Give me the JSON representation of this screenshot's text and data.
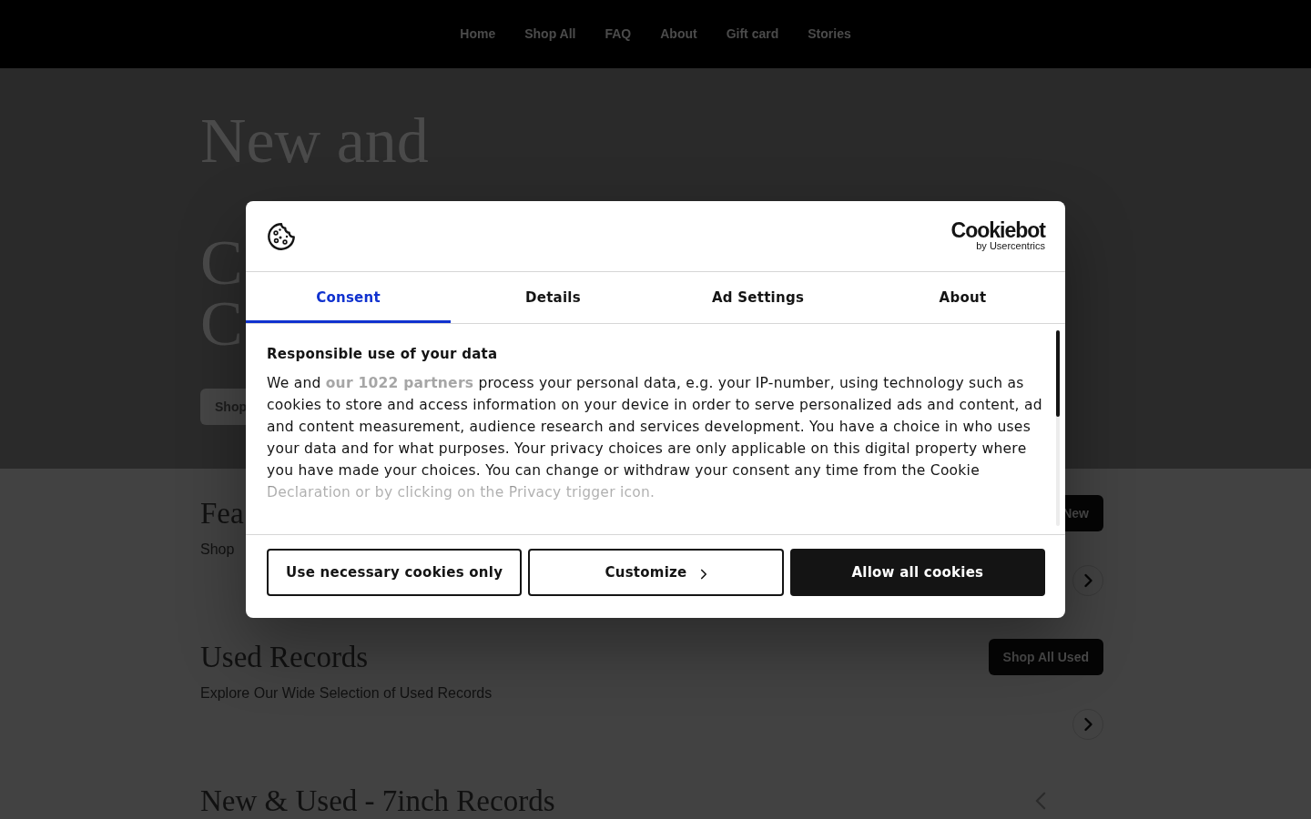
{
  "nav": {
    "links": [
      "Home",
      "Shop All",
      "FAQ",
      "About",
      "Gift card",
      "Stories"
    ]
  },
  "hero": {
    "title_lines": [
      "New and",
      "C",
      "C"
    ],
    "button": "Shop"
  },
  "sections": [
    {
      "title": "Fea",
      "subtitle": "Shop",
      "button": "New",
      "kind": "next_arrow"
    },
    {
      "title": "Used Records",
      "subtitle": "Explore Our Wide Selection of Used Records",
      "button": "Shop All Used",
      "kind": "next_arrow"
    },
    {
      "title": "New & Used - 7inch Records",
      "kind": "prev_arrow"
    }
  ],
  "cookie_dialog": {
    "brand": {
      "name": "Cookiebot",
      "byline": "by Usercentrics"
    },
    "tabs": [
      {
        "label": "Consent",
        "selected": true
      },
      {
        "label": "Details",
        "selected": false
      },
      {
        "label": "Ad Settings",
        "selected": false
      },
      {
        "label": "About",
        "selected": false
      }
    ],
    "heading": "Responsible use of your data",
    "paragraph": [
      {
        "kind": "text",
        "text": "We and "
      },
      {
        "kind": "link",
        "text": "our 1022 partners"
      },
      {
        "kind": "text",
        "text": " process your personal data, e.g. your IP-number, using technology such as cookies to store and access information on your device in order to serve personalized ads and content, ad and content measurement, audience research and services development. You have a choice in who uses your data and for what purposes. Your privacy choices are only applicable on this digital property where you have made your choices. You can change or withdraw your consent any time from the Cookie Declaration or by clicking on the Privacy trigger icon."
      }
    ],
    "buttons": [
      {
        "label": "Use necessary cookies only",
        "kind": "outline"
      },
      {
        "label": "Customize",
        "kind": "expand"
      },
      {
        "label": "Allow all cookies",
        "kind": "filled"
      }
    ]
  }
}
